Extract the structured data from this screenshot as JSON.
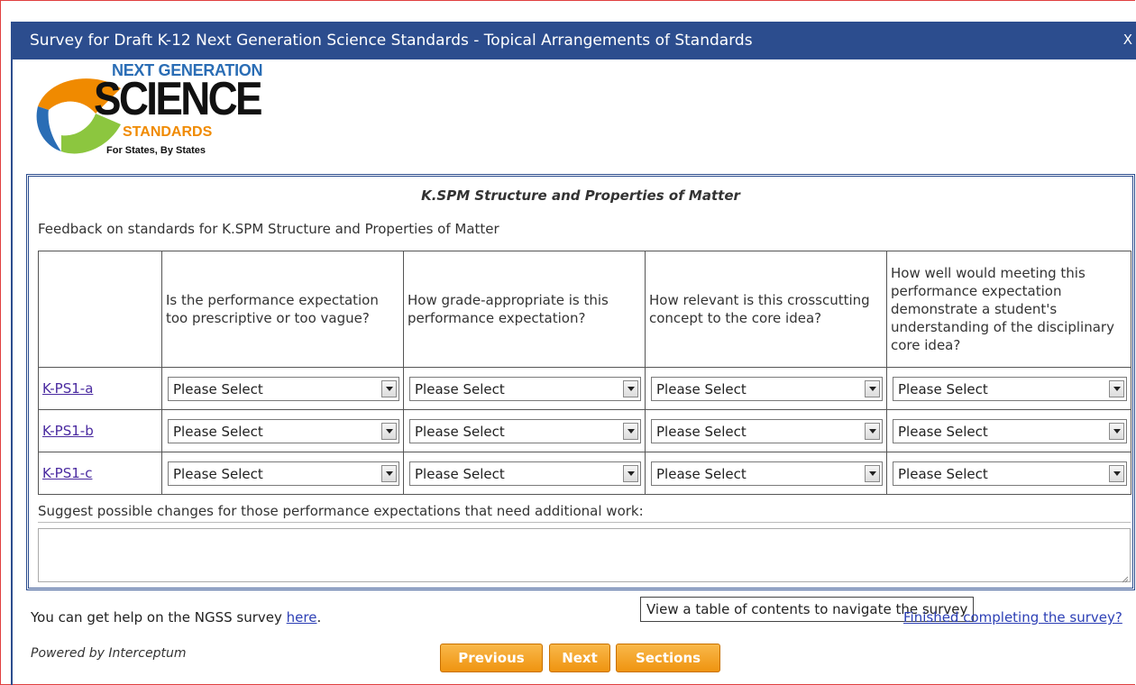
{
  "window": {
    "title": "Survey for Draft K-12 Next Generation Science Standards - Topical Arrangements of Standards",
    "close_label": "X"
  },
  "logo": {
    "line1": "NEXT GENERATION",
    "line2": "SCIENCE",
    "line3": "STANDARDS",
    "tagline": "For States, By States",
    "colors": {
      "orange": "#f08a00",
      "blue": "#2a6db5",
      "green": "#8cc63f",
      "text": "#111111"
    }
  },
  "section": {
    "title": "K.SPM Structure and Properties of Matter",
    "feedback_text": "Feedback on standards for K.SPM Structure and Properties of Matter",
    "columns": [
      "",
      "Is the performance expectation too prescriptive or too vague?",
      "How grade-appropriate is this performance expectation?",
      "How relevant is this crosscutting concept to the core idea?",
      "How well would meeting this performance expectation demonstrate a student's understanding of the disciplinary core idea?"
    ],
    "rows": [
      {
        "label": "K-PS1-a",
        "values": [
          "Please Select",
          "Please Select",
          "Please Select",
          "Please Select"
        ]
      },
      {
        "label": "K-PS1-b",
        "values": [
          "Please Select",
          "Please Select",
          "Please Select",
          "Please Select"
        ]
      },
      {
        "label": "K-PS1-c",
        "values": [
          "Please Select",
          "Please Select",
          "Please Select",
          "Please Select"
        ]
      }
    ],
    "suggest_label": "Suggest possible changes for those performance expectations that need additional work:",
    "suggest_value": "",
    "tooltip": "View a table of contents to navigate the survey"
  },
  "footer": {
    "help_prefix": "You can get help on the NGSS survey ",
    "help_link": "here",
    "help_suffix": ".",
    "finished_link": "Finished completing the survey?",
    "powered_by": "Powered by Interceptum",
    "buttons": {
      "previous": "Previous",
      "next": "Next",
      "sections": "Sections"
    }
  },
  "colors": {
    "titlebar": "#2c4d8e",
    "button": "#ef9410",
    "link": "#2c3fb5"
  }
}
